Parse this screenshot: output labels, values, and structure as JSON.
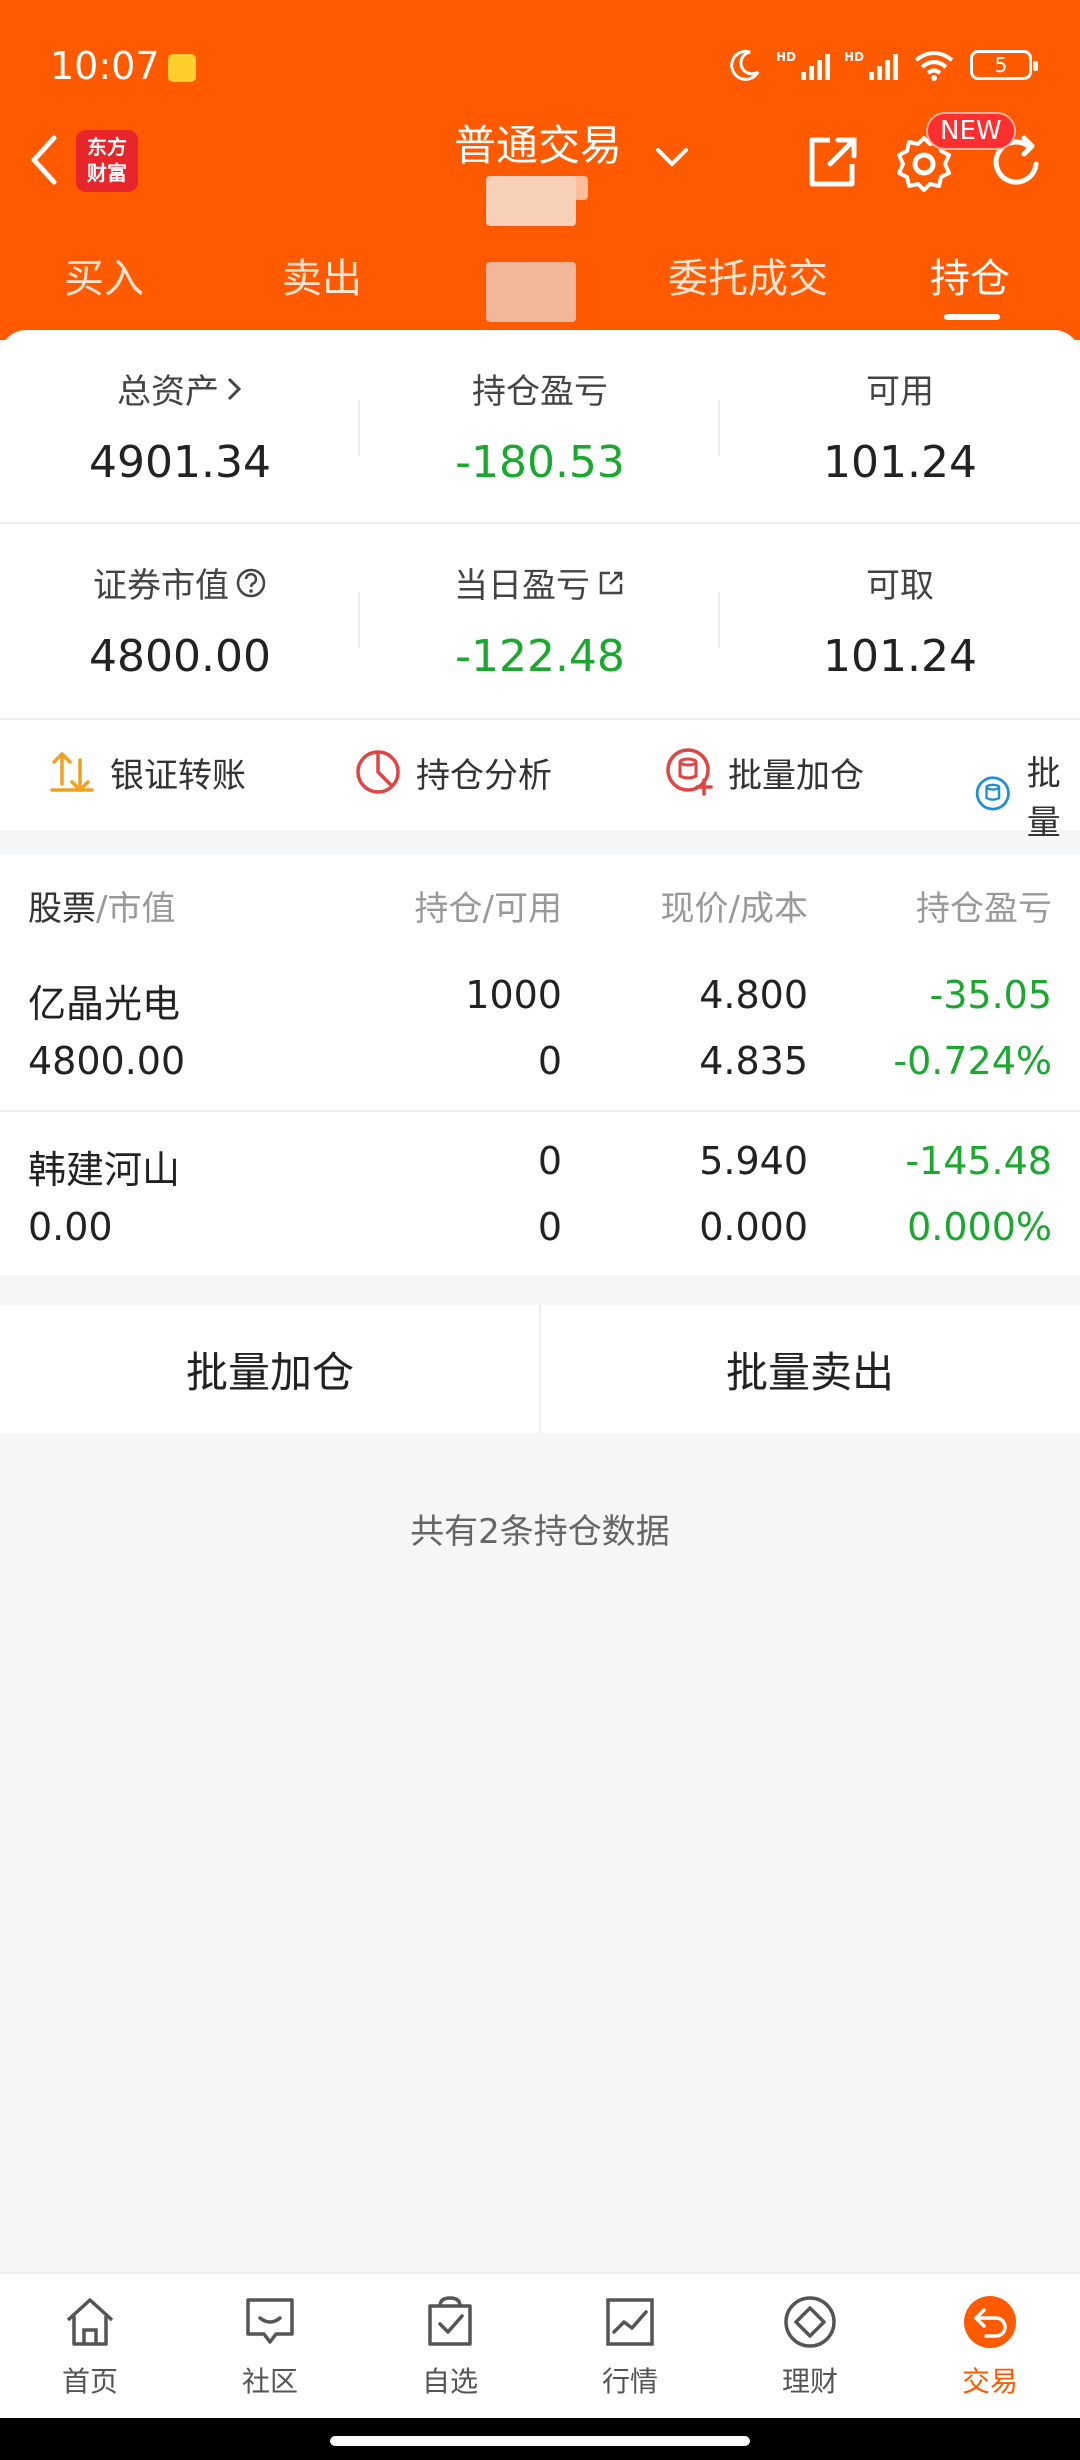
{
  "status": {
    "time": "10:07",
    "signal_label": "HD",
    "battery": "5"
  },
  "nav": {
    "logo_line1": "东方",
    "logo_line2": "财富",
    "title": "普通交易",
    "new_badge": "NEW"
  },
  "tabs": [
    {
      "label": "买入"
    },
    {
      "label": "卖出"
    },
    {
      "label": "委托成交"
    },
    {
      "label": "持仓"
    }
  ],
  "summary": {
    "total_assets_label": "总资产",
    "total_assets": "4901.34",
    "holding_pl_label": "持仓盈亏",
    "holding_pl": "-180.53",
    "available_label": "可用",
    "available": "101.24",
    "market_value_label": "证券市值",
    "market_value": "4800.00",
    "daily_pl_label": "当日盈亏",
    "daily_pl": "-122.48",
    "withdrawable_label": "可取",
    "withdrawable": "101.24"
  },
  "quick_actions": [
    {
      "label": "银证转账",
      "icon": "transfer-icon"
    },
    {
      "label": "持仓分析",
      "icon": "pie-chart-icon"
    },
    {
      "label": "批量加仓",
      "icon": "batch-add-icon"
    },
    {
      "label": "批量",
      "icon": "batch-icon"
    }
  ],
  "table": {
    "headers": {
      "stock": "股票",
      "stock_sub": "/市值",
      "position": "持仓/可用",
      "price": "现价/成本",
      "pl": "持仓盈亏"
    },
    "rows": [
      {
        "name": "亿晶光电",
        "market_value": "4800.00",
        "position": "1000",
        "available": "0",
        "price": "4.800",
        "cost": "4.835",
        "pl": "-35.05",
        "pl_pct": "-0.724%"
      },
      {
        "name": "韩建河山",
        "market_value": "0.00",
        "position": "0",
        "available": "0",
        "price": "5.940",
        "cost": "0.000",
        "pl": "-145.48",
        "pl_pct": "0.000%"
      }
    ]
  },
  "actions": {
    "batch_add": "批量加仓",
    "batch_sell": "批量卖出"
  },
  "footer_note": "共有2条持仓数据",
  "bottom_nav": [
    {
      "label": "首页",
      "icon": "home-icon"
    },
    {
      "label": "社区",
      "icon": "community-icon"
    },
    {
      "label": "自选",
      "icon": "watchlist-icon"
    },
    {
      "label": "行情",
      "icon": "market-icon"
    },
    {
      "label": "理财",
      "icon": "wealth-icon"
    },
    {
      "label": "交易",
      "icon": "trade-icon"
    }
  ],
  "colors": {
    "brand": "#ff5a00",
    "loss_green": "#1aa82f"
  }
}
